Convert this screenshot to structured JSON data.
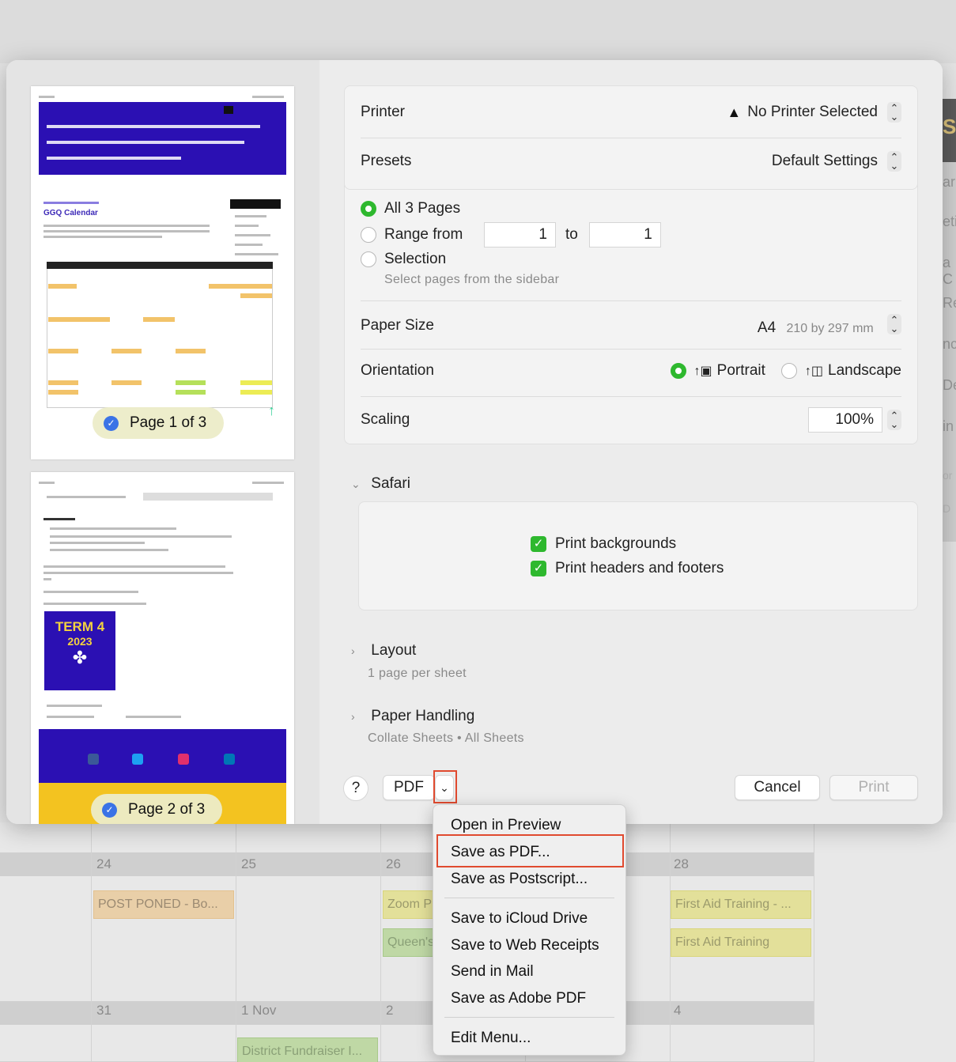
{
  "background_calendar": {
    "dates": [
      "24",
      "25",
      "26",
      "28",
      "31",
      "1 Nov",
      "2",
      "4"
    ],
    "events": [
      "POST PONED - Bo...",
      "Zoom P",
      "Queen's",
      "First Aid Training - ...",
      "First Aid Training",
      "District Fundraiser I..."
    ],
    "right_edge_text": [
      "S",
      "ar",
      "eti",
      "a C",
      "Re",
      "nc",
      "De",
      "in",
      "or",
      "D"
    ]
  },
  "sidebar": {
    "pages": [
      {
        "label": "Page 1 of 3",
        "site_title": "GGQ Calendar"
      },
      {
        "label": "Page 2 of 3",
        "term_line1": "TERM 4",
        "term_line2": "2023"
      }
    ]
  },
  "printer": {
    "label": "Printer",
    "value": "No Printer Selected"
  },
  "presets": {
    "label": "Presets",
    "value": "Default Settings"
  },
  "pages": {
    "all_label": "All 3 Pages",
    "range_label": "Range from",
    "range_from": "1",
    "range_to_label": "to",
    "range_to": "1",
    "selection_label": "Selection",
    "selection_hint": "Select pages from the sidebar"
  },
  "paper_size": {
    "label": "Paper Size",
    "value": "A4",
    "detail": "210 by 297 mm"
  },
  "orientation": {
    "label": "Orientation",
    "portrait": "Portrait",
    "landscape": "Landscape",
    "selected": "portrait"
  },
  "scaling": {
    "label": "Scaling",
    "value": "100%"
  },
  "safari": {
    "title": "Safari",
    "print_backgrounds": "Print backgrounds",
    "print_headers_footers": "Print headers and footers"
  },
  "layout": {
    "title": "Layout",
    "summary": "1 page per sheet"
  },
  "paper_handling": {
    "title": "Paper Handling",
    "summary": "Collate Sheets • All Sheets"
  },
  "footer": {
    "help": "?",
    "pdf": "PDF",
    "cancel": "Cancel",
    "print": "Print"
  },
  "pdf_menu": {
    "items": [
      "Open in Preview",
      "Save as PDF...",
      "Save as Postscript...",
      "Save to iCloud Drive",
      "Save to Web Receipts",
      "Send in Mail",
      "Save as Adobe PDF",
      "Edit Menu..."
    ],
    "highlighted": "Save as PDF..."
  },
  "colors": {
    "accent_green": "#2eb82e",
    "highlight_red": "#e04a2f",
    "site_purple": "#2b10b3",
    "badge_blue": "#3b73e6"
  }
}
